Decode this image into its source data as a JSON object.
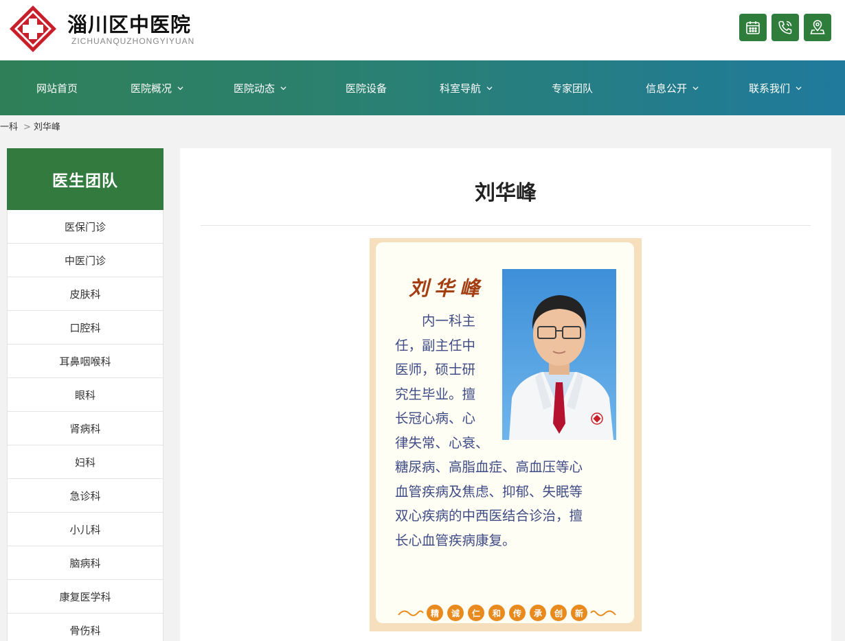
{
  "site": {
    "name": "淄川区中医院",
    "pinyin": "ZICHUANQUZHONGYIYUAN"
  },
  "header_buttons": [
    {
      "icon": "calendar-icon"
    },
    {
      "icon": "phone-icon"
    },
    {
      "icon": "location-pin-icon"
    }
  ],
  "nav": {
    "items": [
      {
        "label": "网站首页",
        "has_dropdown": false
      },
      {
        "label": "医院概况",
        "has_dropdown": true
      },
      {
        "label": "医院动态",
        "has_dropdown": true
      },
      {
        "label": "医院设备",
        "has_dropdown": false
      },
      {
        "label": "科室导航",
        "has_dropdown": true
      },
      {
        "label": "专家团队",
        "has_dropdown": false
      },
      {
        "label": "信息公开",
        "has_dropdown": true
      },
      {
        "label": "联系我们",
        "has_dropdown": true
      }
    ]
  },
  "breadcrumb": {
    "parent": "一科",
    "separator": ">",
    "current": "刘华峰"
  },
  "sidebar": {
    "title": "医生团队",
    "items": [
      {
        "label": "医保门诊"
      },
      {
        "label": "中医门诊"
      },
      {
        "label": "皮肤科"
      },
      {
        "label": "口腔科"
      },
      {
        "label": "耳鼻咽喉科"
      },
      {
        "label": "眼科"
      },
      {
        "label": "肾病科"
      },
      {
        "label": "妇科"
      },
      {
        "label": "急诊科"
      },
      {
        "label": "小儿科"
      },
      {
        "label": "脑病科"
      },
      {
        "label": "康复医学科"
      },
      {
        "label": "骨伤科"
      }
    ]
  },
  "doctor": {
    "title": "刘华峰",
    "card": {
      "name": "刘华峰",
      "bio_lines_narrow": [
        "　　内一科主",
        "任，副主任中",
        "医师，硕士研",
        "究生毕业。擅",
        "长冠心病、心",
        "律失常、心衰、"
      ],
      "bio_lines_wide": [
        "糖尿病、高脂血症、高血压等心",
        "血管疾病及焦虑、抑郁、失眠等",
        "双心疾病的中西医结合诊治，擅",
        "长心血管疾病康复。"
      ],
      "motto": [
        "精",
        "诚",
        "仁",
        "和",
        "传",
        "承",
        "创",
        "新"
      ]
    }
  },
  "colors": {
    "brand_green": "#2e7d3a",
    "sidebar_head": "#327a3e",
    "nav_start": "#2f8058",
    "nav_end": "#1f7a9c",
    "card_border": "#f5dfbc",
    "card_name": "#a33d12",
    "card_text": "#3f4c86",
    "motto_orange": "#e88a1d"
  }
}
